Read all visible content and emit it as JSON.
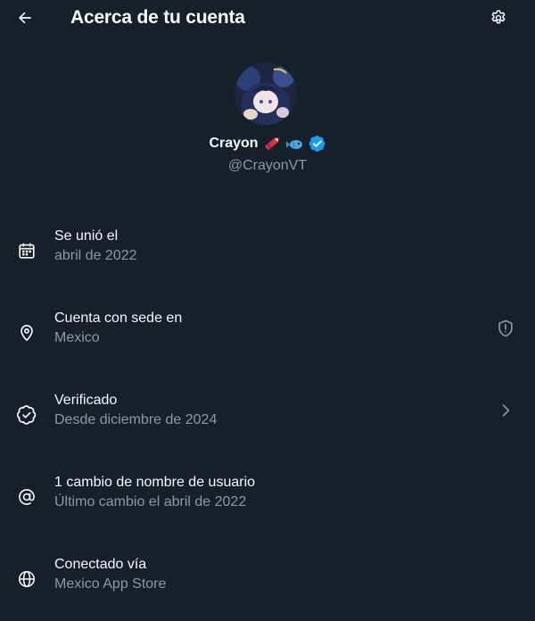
{
  "header": {
    "title": "Acerca de tu cuenta",
    "back_icon": "arrow-left-icon",
    "settings_icon": "gear-icon"
  },
  "profile": {
    "display_name": "Crayon",
    "name_emojis": [
      "crayon-emoji",
      "fish-emoji"
    ],
    "verified_badge": "verified-badge-icon",
    "handle": "@CrayonVT"
  },
  "rows": [
    {
      "icon": "calendar-icon",
      "title": "Se unió el",
      "subtitle": "abril de 2022",
      "trailing": ""
    },
    {
      "icon": "location-pin-icon",
      "title": "Cuenta con sede en",
      "subtitle": "Mexico",
      "trailing": "shield-alert-icon"
    },
    {
      "icon": "verified-check-icon",
      "title": "Verificado",
      "subtitle": "Desde diciembre de 2024",
      "trailing": "chevron-right-icon"
    },
    {
      "icon": "at-sign-icon",
      "title": "1 cambio de nombre de usuario",
      "subtitle": "Último cambio el abril de 2022",
      "trailing": ""
    },
    {
      "icon": "globe-icon",
      "title": "Conectado vía",
      "subtitle": "Mexico App Store",
      "trailing": ""
    }
  ],
  "colors": {
    "background": "#15202b",
    "primary_text": "#f7f9f9",
    "secondary_text": "#8b98a5",
    "verified_blue": "#1d9bf0"
  }
}
